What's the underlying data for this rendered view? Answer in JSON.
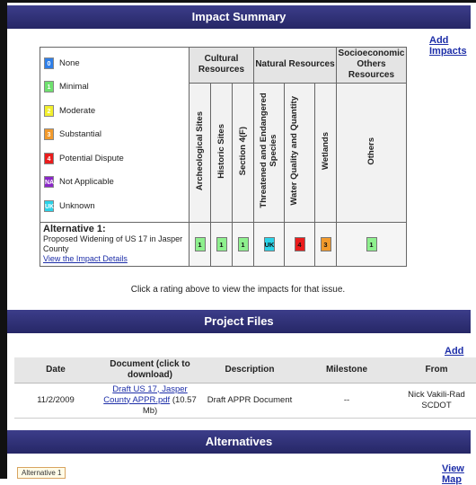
{
  "impact_summary": {
    "header": "Impact Summary",
    "add_impacts": "Add Impacts",
    "legend": [
      {
        "code": "0",
        "label": "None",
        "color": "#2f7fe8"
      },
      {
        "code": "1",
        "label": "Minimal",
        "color": "#6fe06f"
      },
      {
        "code": "2",
        "label": "Moderate",
        "color": "#f2ef2c"
      },
      {
        "code": "3",
        "label": "Substantial",
        "color": "#f29a2c"
      },
      {
        "code": "4",
        "label": "Potential Dispute",
        "color": "#ea1c1c"
      },
      {
        "code": "NA",
        "label": "Not Applicable",
        "color": "#8a26c8"
      },
      {
        "code": "UK",
        "label": "Unknown",
        "color": "#2ad3e8"
      }
    ],
    "groups": [
      "Cultural Resources",
      "Natural Resources",
      "Socioeconomic Others Resources"
    ],
    "columns": [
      "Archeological Sites",
      "Historic Sites",
      "Section 4(F)",
      "Threatened and Endangered Species",
      "Water Quality and Quantity",
      "Wetlands",
      "Others"
    ],
    "alternative": {
      "title": "Alternative 1:",
      "description": "Proposed Widening of US 17 in Jasper County",
      "link": "View the Impact Details",
      "ratings": [
        {
          "code": "1",
          "color": "#8ef08e"
        },
        {
          "code": "1",
          "color": "#8ef08e"
        },
        {
          "code": "1",
          "color": "#8ef08e"
        },
        {
          "code": "UK",
          "color": "#2ad3e8"
        },
        {
          "code": "4",
          "color": "#ea1c1c"
        },
        {
          "code": "3",
          "color": "#f29a2c"
        },
        {
          "code": "1",
          "color": "#8ef08e"
        }
      ]
    },
    "note": "Click a rating above to view the impacts for that issue."
  },
  "project_files": {
    "header": "Project Files",
    "add_file": "Add File",
    "columns": [
      "Date",
      "Document (click to download)",
      "Description",
      "Milestone",
      "From"
    ],
    "rows": [
      {
        "date": "11/2/2009",
        "document": "Draft US 17, Jasper County APPR.pdf",
        "size": "(10.57 Mb)",
        "description": "Draft APPR Document",
        "milestone": "--",
        "from": "Nick Vakili-Rad SCDOT"
      }
    ]
  },
  "alternatives": {
    "header": "Alternatives",
    "tab": "Alternative 1",
    "view_map": "View Map"
  }
}
